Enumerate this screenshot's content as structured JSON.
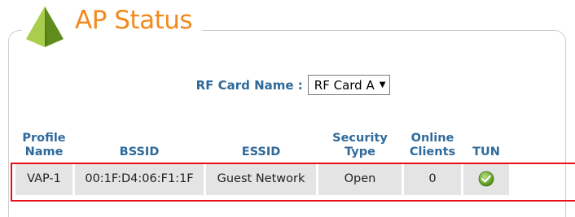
{
  "header": {
    "title": "AP Status"
  },
  "rf_card": {
    "label": "RF Card Name :",
    "selected": "RF Card A",
    "arrow": "▼"
  },
  "table": {
    "columns": [
      "Profile Name",
      "BSSID",
      "ESSID",
      "Security Type",
      "Online Clients",
      "TUN"
    ],
    "rows": [
      {
        "profile_name": "VAP-1",
        "bssid": "00:1F:D4:06:F1:1F",
        "essid": "Guest Network",
        "security_type": "Open",
        "online_clients": "0",
        "tun_icon": "green-check-icon"
      }
    ]
  },
  "colors": {
    "title": "#f28a1d",
    "header_text": "#2f6a9b",
    "row_background": "#e4e4e4",
    "highlight_border": "#e8101a",
    "logo_green": "#6a9a23"
  }
}
